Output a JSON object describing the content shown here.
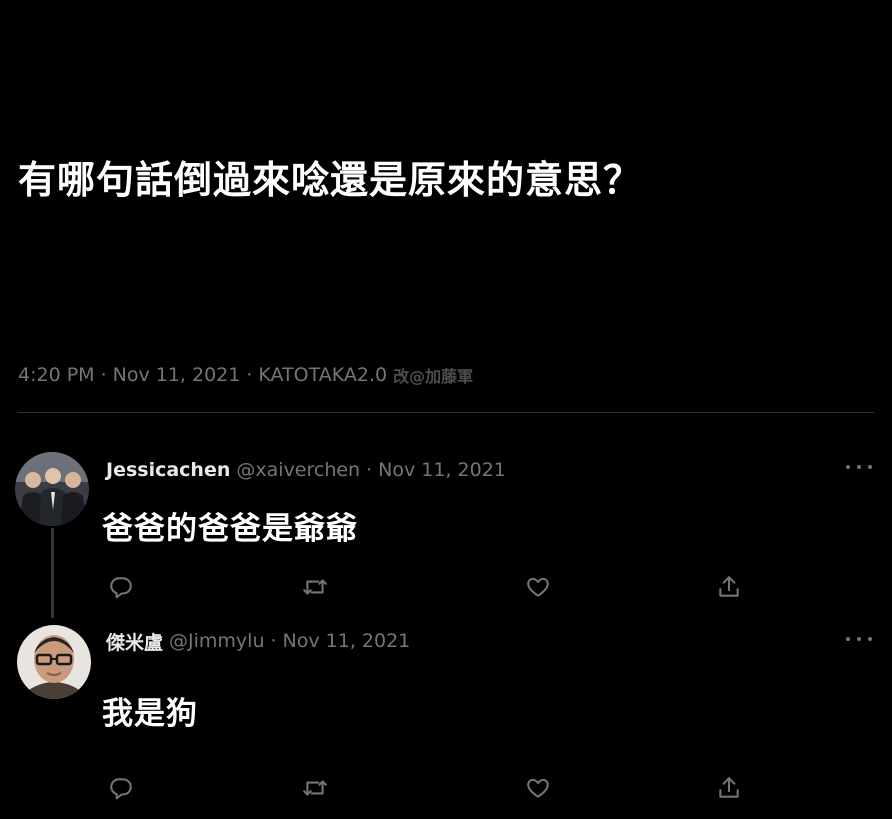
{
  "tweet": {
    "text": "有哪句話倒過來唸還是原來的意思？",
    "time": "4:20 PM",
    "date": "Nov 11, 2021",
    "client": "KATOTAKA2.0",
    "watermark": "改@加藤軍"
  },
  "replies": [
    {
      "name": "Jessicachen",
      "handle": "@xaiverchen",
      "date": "Nov 11, 2021",
      "text": "爸爸的爸爸是爺爺",
      "avatar_icon": "group-photo-avatar"
    },
    {
      "name": "傑米盧",
      "handle": "@Jimmylu",
      "date": "Nov 11, 2021",
      "text": "我是狗",
      "avatar_icon": "man-with-glasses-avatar"
    }
  ],
  "icons": {
    "reply": "reply-icon",
    "retweet": "retweet-icon",
    "like": "like-icon",
    "share": "share-icon",
    "more": "more-icon"
  },
  "colors": {
    "background": "#000000",
    "text": "#e7e9ea",
    "muted": "#71767b",
    "divider": "#2f3336"
  }
}
